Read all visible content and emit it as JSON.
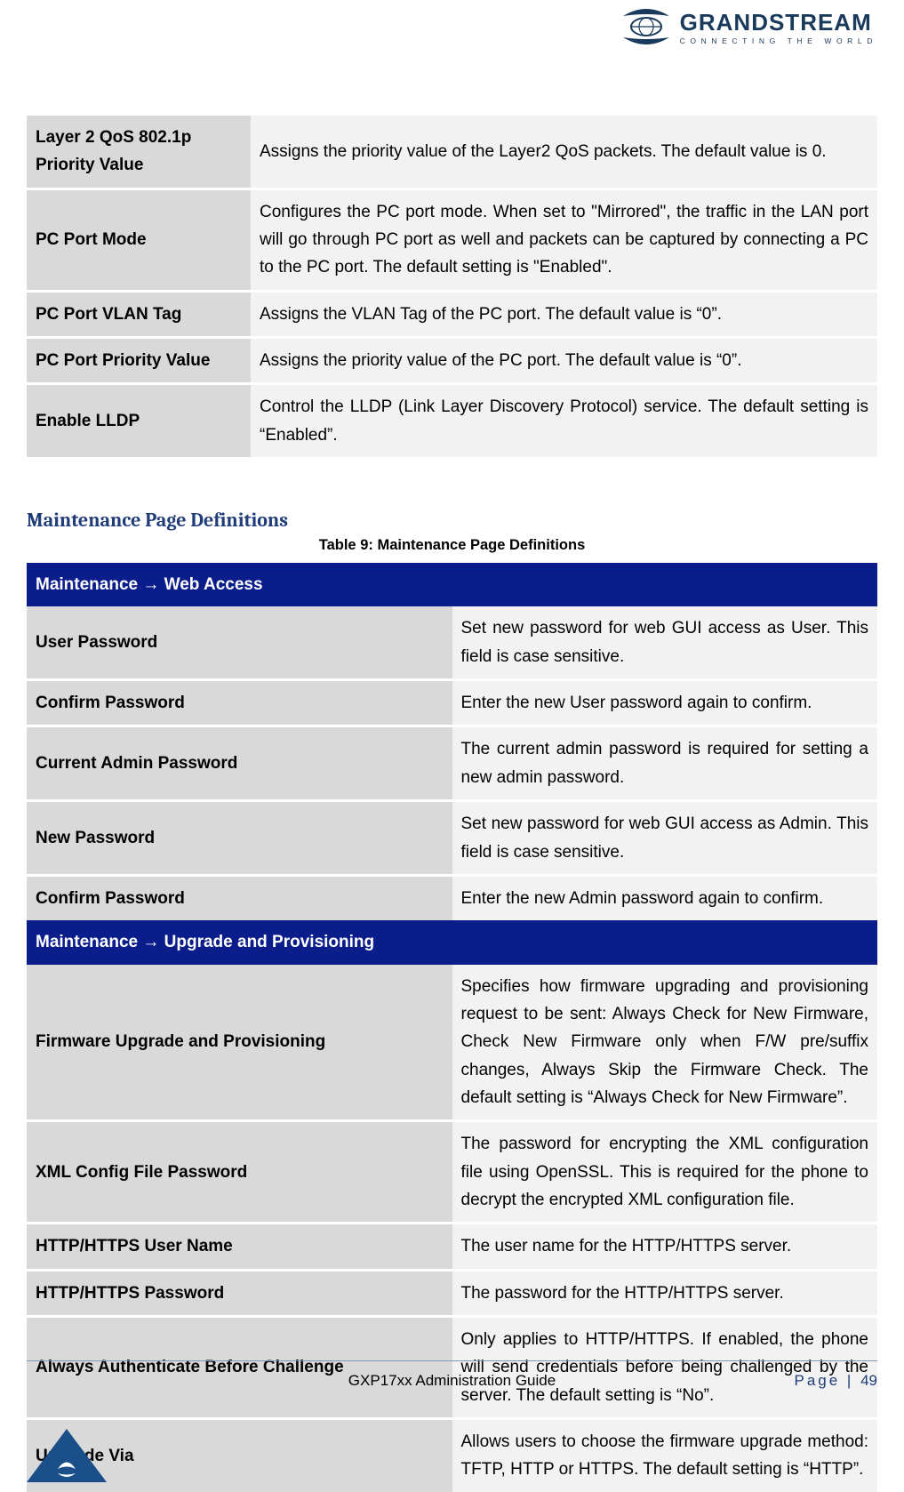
{
  "brand": {
    "name": "GRANDSTREAM",
    "tagline": "CONNECTING THE WORLD"
  },
  "table1": {
    "rows": [
      {
        "key": "Layer 2 QoS 802.1p Priority Value",
        "val": "Assigns the priority value of the Layer2 QoS packets. The default value is 0."
      },
      {
        "key": "PC Port Mode",
        "val": "Configures the PC port mode. When set to \"Mirrored\", the traffic in the LAN port will go through PC port as well and packets can be captured by connecting a PC to the PC port. The default setting is \"Enabled\"."
      },
      {
        "key": "PC Port VLAN Tag",
        "val": "Assigns the VLAN Tag of the PC port. The default value is “0”."
      },
      {
        "key": "PC Port Priority Value",
        "val": "Assigns the priority value of the PC port. The default value is “0”."
      },
      {
        "key": "Enable LLDP",
        "val": "Control the LLDP (Link Layer Discovery Protocol) service. The default setting is “Enabled”."
      }
    ]
  },
  "section": {
    "heading": "Maintenance Page Definitions",
    "caption": "Table 9: Maintenance Page Definitions"
  },
  "table2": {
    "header1_a": "Maintenance ",
    "header1_b": " Web Access",
    "rows1": [
      {
        "key": "User Password",
        "val": "Set new password for web GUI access as User. This field is case sensitive."
      },
      {
        "key": "Confirm Password",
        "val": "Enter the new User password again to confirm."
      },
      {
        "key": "Current Admin Password",
        "val": "The current admin password is required for setting a new admin password."
      },
      {
        "key": "New Password",
        "val": "Set new password for web GUI access as Admin. This field is case sensitive."
      },
      {
        "key": "Confirm Password",
        "val": "Enter the new Admin password again to confirm."
      }
    ],
    "header2_a": "Maintenance ",
    "header2_b": " Upgrade and Provisioning",
    "rows2": [
      {
        "key": "Firmware Upgrade and Provisioning",
        "val": "Specifies how firmware upgrading and provisioning request to be sent: Always Check for New Firmware, Check New Firmware only when F/W pre/suffix changes, Always Skip the Firmware Check. The default setting is “Always Check for New Firmware”."
      },
      {
        "key": "XML Config File Password",
        "val": "The password for encrypting the XML configuration file using OpenSSL. This is required for the phone to decrypt the encrypted XML configuration file."
      },
      {
        "key": "HTTP/HTTPS User Name",
        "val": "The user name for the HTTP/HTTPS server."
      },
      {
        "key": "HTTP/HTTPS Password",
        "val": "The password for the HTTP/HTTPS server."
      },
      {
        "key": "Always Authenticate Before Challenge",
        "val": "Only applies to HTTP/HTTPS. If enabled, the phone will send credentials before being challenged by the server. The default setting is “No”."
      },
      {
        "key": "Upgrade Via",
        "val": "Allows users to choose the firmware upgrade method: TFTP, HTTP or HTTPS. The default setting is “HTTP”."
      }
    ]
  },
  "footer": {
    "center": "GXP17xx Administration Guide",
    "right_label": "Page | ",
    "right_num": "49"
  }
}
